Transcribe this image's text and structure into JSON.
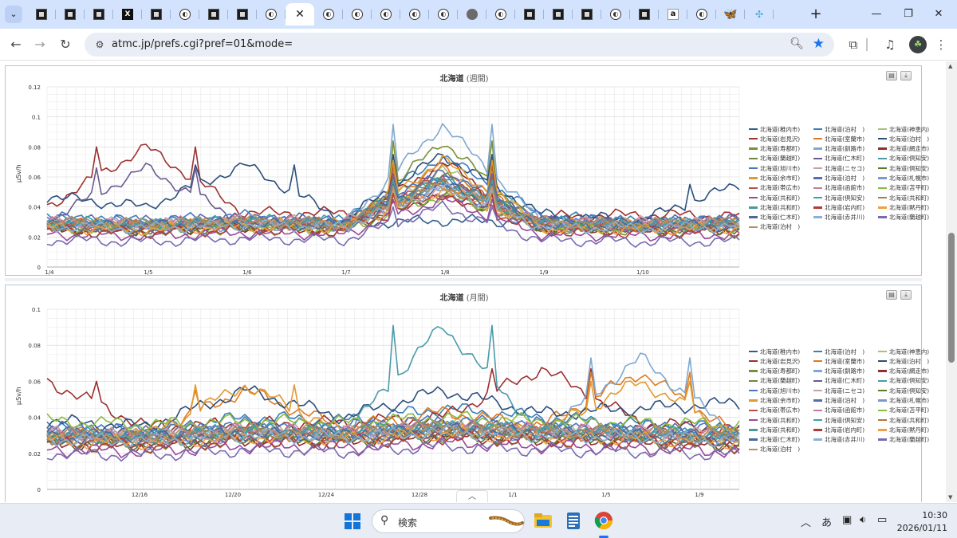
{
  "browser": {
    "tabs": [
      {
        "icon": "nerv-favicon"
      },
      {
        "icon": "nerv-favicon"
      },
      {
        "icon": "nerv-favicon"
      },
      {
        "icon": "x-favicon",
        "glyph": "X"
      },
      {
        "icon": "nerv-favicon"
      },
      {
        "icon": "circle-favicon",
        "glyph": "◐"
      },
      {
        "icon": "nerv-favicon"
      },
      {
        "icon": "nerv-favicon"
      },
      {
        "icon": "circle-favicon",
        "glyph": "◐"
      },
      {
        "icon": "close-icon",
        "glyph": "✕",
        "active": true
      },
      {
        "icon": "circle-favicon",
        "glyph": "◐"
      },
      {
        "icon": "circle-favicon",
        "glyph": "◐"
      },
      {
        "icon": "circle-favicon",
        "glyph": "◐"
      },
      {
        "icon": "circle-favicon",
        "glyph": "◐"
      },
      {
        "icon": "circle-favicon",
        "glyph": "◐"
      },
      {
        "icon": "globe-favicon"
      },
      {
        "icon": "circle-favicon",
        "glyph": "◐"
      },
      {
        "icon": "nerv-favicon"
      },
      {
        "icon": "nerv-favicon"
      },
      {
        "icon": "nerv-favicon"
      },
      {
        "icon": "circle-favicon",
        "glyph": "◐"
      },
      {
        "icon": "nerv-favicon"
      },
      {
        "icon": "amazon-favicon",
        "glyph": "a"
      },
      {
        "icon": "circle-favicon",
        "glyph": "◐"
      },
      {
        "icon": "bluesky-favicon",
        "glyph": "🦋"
      },
      {
        "icon": "dots-favicon",
        "glyph": "✣"
      }
    ],
    "new_tab_glyph": "+",
    "url": "atmc.jp/prefs.cgi?pref=01&mode="
  },
  "charts": {
    "week": {
      "pref_title": "北海道",
      "period": "(週間)",
      "ylabel": "μSv/h",
      "yticks": [
        "0",
        "0.02",
        "0.04",
        "0.06",
        "0.08",
        "0.1",
        "0.12"
      ],
      "xticks": [
        "1/4",
        "1/5",
        "1/6",
        "1/7",
        "1/8",
        "1/9",
        "1/10"
      ]
    },
    "month": {
      "pref_title": "北海道",
      "period": "(月間)",
      "ylabel": "μSv/h",
      "yticks": [
        "0",
        "0.02",
        "0.04",
        "0.06",
        "0.08",
        "0.1"
      ],
      "xticks": [
        "12/16",
        "12/20",
        "12/24",
        "12/28",
        "1/1",
        "1/5",
        "1/9"
      ]
    }
  },
  "chart_data": [
    {
      "type": "line",
      "title": "北海道 (週間)",
      "ylabel": "μSv/h",
      "ylim": [
        0,
        0.12
      ],
      "x": [
        "1/4",
        "1/5",
        "1/6",
        "1/7",
        "1/8",
        "1/9",
        "1/10"
      ],
      "legend_position": "right",
      "grid": true,
      "series": [
        {
          "name": "北海道(稚内市)",
          "color": "#2f5f8f",
          "values": [
            0.03,
            0.028,
            0.032,
            0.029,
            0.031,
            0.03,
            0.028,
            0.029
          ]
        },
        {
          "name": "北海道(泊村　)",
          "color": "#3a7fb8",
          "values": [
            0.032,
            0.03,
            0.029,
            0.031,
            0.074,
            0.034,
            0.03,
            0.031
          ]
        },
        {
          "name": "北海道(神恵内)",
          "color": "#a8c07a",
          "values": [
            0.029,
            0.027,
            0.03,
            0.028,
            0.065,
            0.03,
            0.029,
            0.028
          ]
        },
        {
          "name": "北海道(岩見沢)",
          "color": "#9c3030",
          "values": [
            0.04,
            0.08,
            0.036,
            0.036,
            0.046,
            0.033,
            0.035,
            0.034
          ]
        },
        {
          "name": "北海道(室蘭市)",
          "color": "#e07a20",
          "values": [
            0.029,
            0.028,
            0.03,
            0.029,
            0.066,
            0.028,
            0.029,
            0.03
          ]
        },
        {
          "name": "北海道(泊村　)",
          "color": "#2c4f7c",
          "values": [
            0.047,
            0.04,
            0.068,
            0.031,
            0.075,
            0.035,
            0.031,
            0.055
          ]
        },
        {
          "name": "北海道(寿都町)",
          "color": "#7a8f3a",
          "values": [
            0.024,
            0.023,
            0.025,
            0.024,
            0.084,
            0.026,
            0.025,
            0.023
          ]
        },
        {
          "name": "北海道(釧路市)",
          "color": "#7fa8d0",
          "values": [
            0.028,
            0.029,
            0.027,
            0.028,
            0.095,
            0.03,
            0.028,
            0.029
          ]
        },
        {
          "name": "北海道(網走市)",
          "color": "#8f2f2f",
          "values": [
            0.026,
            0.025,
            0.027,
            0.025,
            0.07,
            0.026,
            0.025,
            0.026
          ]
        },
        {
          "name": "北海道(蘭越町)",
          "color": "#6a8a3a",
          "values": [
            0.027,
            0.026,
            0.028,
            0.027,
            0.06,
            0.027,
            0.026,
            0.027
          ]
        },
        {
          "name": "北海道(仁木町)",
          "color": "#6a5a8f",
          "values": [
            0.031,
            0.066,
            0.029,
            0.03,
            0.055,
            0.03,
            0.029,
            0.031
          ]
        },
        {
          "name": "北海道(倶知安)",
          "color": "#4a9aaa",
          "values": [
            0.028,
            0.027,
            0.029,
            0.028,
            0.058,
            0.028,
            0.027,
            0.028
          ]
        },
        {
          "name": "北海道(旭川市)",
          "color": "#4a76c0",
          "values": [
            0.033,
            0.031,
            0.034,
            0.03,
            0.062,
            0.032,
            0.03,
            0.031
          ]
        },
        {
          "name": "北海道(ニセコ)",
          "color": "#c8a0a0",
          "values": [
            0.03,
            0.029,
            0.031,
            0.03,
            0.055,
            0.029,
            0.03,
            0.029
          ]
        },
        {
          "name": "北海道(倶知安)",
          "color": "#5a7a2a",
          "values": [
            0.025,
            0.024,
            0.026,
            0.025,
            0.05,
            0.025,
            0.024,
            0.025
          ]
        },
        {
          "name": "北海道(余市町)",
          "color": "#e09a30",
          "values": [
            0.029,
            0.028,
            0.03,
            0.028,
            0.071,
            0.029,
            0.028,
            0.029
          ]
        },
        {
          "name": "北海道(泊村　)",
          "color": "#5a6ab0",
          "values": [
            0.031,
            0.03,
            0.032,
            0.03,
            0.062,
            0.031,
            0.03,
            0.031
          ]
        },
        {
          "name": "北海道(札幌市)",
          "color": "#7a9ac8",
          "values": [
            0.027,
            0.026,
            0.028,
            0.026,
            0.052,
            0.026,
            0.027,
            0.026
          ]
        },
        {
          "name": "北海道(帯広市)",
          "color": "#b8504a",
          "values": [
            0.028,
            0.027,
            0.029,
            0.027,
            0.06,
            0.028,
            0.027,
            0.028
          ]
        },
        {
          "name": "北海道(函館市)",
          "color": "#c87a9a",
          "values": [
            0.03,
            0.029,
            0.031,
            0.029,
            0.05,
            0.03,
            0.029,
            0.03
          ]
        },
        {
          "name": "北海道(苫平町)",
          "color": "#8aba40",
          "values": [
            0.026,
            0.025,
            0.027,
            0.025,
            0.048,
            0.026,
            0.025,
            0.026
          ]
        },
        {
          "name": "北海道(共和町)",
          "color": "#9a4a9a",
          "values": [
            0.022,
            0.021,
            0.023,
            0.022,
            0.045,
            0.022,
            0.021,
            0.022
          ]
        },
        {
          "name": "北海道(倶知安)",
          "color": "#3aa0b0",
          "values": [
            0.03,
            0.029,
            0.031,
            0.03,
            0.058,
            0.03,
            0.029,
            0.03
          ]
        },
        {
          "name": "北海道(共和町)",
          "color": "#b07a40",
          "values": [
            0.028,
            0.027,
            0.029,
            0.028,
            0.056,
            0.028,
            0.027,
            0.028
          ]
        },
        {
          "name": "北海道(共和町)",
          "color": "#4a9a9a",
          "values": [
            0.029,
            0.028,
            0.03,
            0.029,
            0.057,
            0.029,
            0.028,
            0.029
          ]
        },
        {
          "name": "北海道(岩内町)",
          "color": "#b03a3a",
          "values": [
            0.024,
            0.023,
            0.025,
            0.024,
            0.049,
            0.024,
            0.023,
            0.024
          ]
        },
        {
          "name": "北海道(黙丹町)",
          "color": "#f0a040",
          "values": [
            0.026,
            0.025,
            0.027,
            0.026,
            0.052,
            0.026,
            0.025,
            0.026
          ]
        },
        {
          "name": "北海道(仁木町)",
          "color": "#4a6a9a",
          "values": [
            0.028,
            0.027,
            0.029,
            0.028,
            0.055,
            0.028,
            0.027,
            0.028
          ]
        },
        {
          "name": "北海道(赤井川)",
          "color": "#8ab0d8",
          "values": [
            0.027,
            0.026,
            0.028,
            0.027,
            0.053,
            0.027,
            0.026,
            0.027
          ]
        },
        {
          "name": "北海道(蘭越町)",
          "color": "#7a6ab0",
          "values": [
            0.018,
            0.017,
            0.019,
            0.018,
            0.04,
            0.018,
            0.017,
            0.017
          ]
        },
        {
          "name": "北海道(泊村　)",
          "color": "#b89060",
          "values": [
            0.03,
            0.029,
            0.031,
            0.029,
            0.054,
            0.03,
            0.029,
            0.03
          ]
        }
      ]
    },
    {
      "type": "line",
      "title": "北海道 (月間)",
      "ylabel": "μSv/h",
      "ylim": [
        0,
        0.1
      ],
      "x": [
        "12/16",
        "12/20",
        "12/24",
        "12/28",
        "1/1",
        "1/5",
        "1/9"
      ],
      "legend_position": "right",
      "grid": true,
      "series": [
        {
          "name": "北海道(稚内市)",
          "color": "#2f5f8f",
          "values": [
            0.032,
            0.03,
            0.033,
            0.031,
            0.034,
            0.032,
            0.033,
            0.031
          ]
        },
        {
          "name": "北海道(泊村　)",
          "color": "#3a7fb8",
          "values": [
            0.034,
            0.032,
            0.04,
            0.038,
            0.045,
            0.04,
            0.036,
            0.034
          ]
        },
        {
          "name": "北海道(神恵内)",
          "color": "#a8c07a",
          "values": [
            0.03,
            0.029,
            0.033,
            0.031,
            0.036,
            0.033,
            0.031,
            0.03
          ]
        },
        {
          "name": "北海道(岩見沢)",
          "color": "#9c3030",
          "values": [
            0.06,
            0.035,
            0.036,
            0.037,
            0.04,
            0.067,
            0.037,
            0.033
          ]
        },
        {
          "name": "北海道(室蘭市)",
          "color": "#e07a20",
          "values": [
            0.031,
            0.03,
            0.055,
            0.034,
            0.043,
            0.035,
            0.065,
            0.03
          ]
        },
        {
          "name": "北海道(泊村　)",
          "color": "#2c4f7c",
          "values": [
            0.038,
            0.035,
            0.055,
            0.04,
            0.055,
            0.042,
            0.045,
            0.048
          ]
        },
        {
          "name": "北海道(寿都町)",
          "color": "#7a8f3a",
          "values": [
            0.025,
            0.024,
            0.027,
            0.026,
            0.03,
            0.027,
            0.026,
            0.024
          ]
        },
        {
          "name": "北海道(釧路市)",
          "color": "#7fa8d0",
          "values": [
            0.029,
            0.028,
            0.03,
            0.029,
            0.033,
            0.03,
            0.073,
            0.029
          ]
        },
        {
          "name": "北海道(網走市)",
          "color": "#8f2f2f",
          "values": [
            0.026,
            0.025,
            0.028,
            0.027,
            0.03,
            0.028,
            0.027,
            0.025
          ]
        },
        {
          "name": "北海道(蘭越町)",
          "color": "#6a8a3a",
          "values": [
            0.028,
            0.027,
            0.03,
            0.029,
            0.032,
            0.03,
            0.029,
            0.027
          ]
        },
        {
          "name": "北海道(仁木町)",
          "color": "#6a5a8f",
          "values": [
            0.031,
            0.03,
            0.033,
            0.032,
            0.035,
            0.033,
            0.032,
            0.03
          ]
        },
        {
          "name": "北海道(倶知安)",
          "color": "#4a9aaa",
          "values": [
            0.029,
            0.028,
            0.031,
            0.03,
            0.091,
            0.031,
            0.03,
            0.028
          ]
        },
        {
          "name": "北海道(旭川市)",
          "color": "#4a76c0",
          "values": [
            0.034,
            0.033,
            0.036,
            0.035,
            0.038,
            0.036,
            0.035,
            0.033
          ]
        },
        {
          "name": "北海道(ニセコ)",
          "color": "#c8a0a0",
          "values": [
            0.031,
            0.03,
            0.033,
            0.032,
            0.035,
            0.033,
            0.032,
            0.03
          ]
        },
        {
          "name": "北海道(倶知安)",
          "color": "#5a7a2a",
          "values": [
            0.026,
            0.025,
            0.028,
            0.027,
            0.03,
            0.028,
            0.027,
            0.025
          ]
        },
        {
          "name": "北海道(余市町)",
          "color": "#e09a30",
          "values": [
            0.03,
            0.029,
            0.058,
            0.031,
            0.034,
            0.032,
            0.06,
            0.029
          ]
        },
        {
          "name": "北海道(泊村　)",
          "color": "#5a6ab0",
          "values": [
            0.032,
            0.031,
            0.034,
            0.033,
            0.036,
            0.034,
            0.033,
            0.031
          ]
        },
        {
          "name": "北海道(札幌市)",
          "color": "#7a9ac8",
          "values": [
            0.028,
            0.027,
            0.03,
            0.029,
            0.032,
            0.03,
            0.029,
            0.027
          ]
        },
        {
          "name": "北海道(帯広市)",
          "color": "#b8504a",
          "values": [
            0.029,
            0.028,
            0.031,
            0.03,
            0.033,
            0.031,
            0.03,
            0.028
          ]
        },
        {
          "name": "北海道(函館市)",
          "color": "#c87a9a",
          "values": [
            0.031,
            0.03,
            0.033,
            0.032,
            0.035,
            0.033,
            0.032,
            0.03
          ]
        },
        {
          "name": "北海道(苫平町)",
          "color": "#8aba40",
          "values": [
            0.038,
            0.036,
            0.038,
            0.037,
            0.04,
            0.038,
            0.037,
            0.036
          ]
        },
        {
          "name": "北海道(共和町)",
          "color": "#9a4a9a",
          "values": [
            0.022,
            0.021,
            0.024,
            0.023,
            0.026,
            0.024,
            0.023,
            0.021
          ]
        },
        {
          "name": "北海道(倶知安)",
          "color": "#3aa0b0",
          "values": [
            0.031,
            0.03,
            0.033,
            0.032,
            0.035,
            0.033,
            0.032,
            0.03
          ]
        },
        {
          "name": "北海道(共和町)",
          "color": "#b07a40",
          "values": [
            0.029,
            0.028,
            0.031,
            0.03,
            0.033,
            0.031,
            0.03,
            0.028
          ]
        },
        {
          "name": "北海道(共和町)",
          "color": "#4a9a9a",
          "values": [
            0.03,
            0.029,
            0.032,
            0.031,
            0.034,
            0.032,
            0.031,
            0.029
          ]
        },
        {
          "name": "北海道(岩内町)",
          "color": "#b03a3a",
          "values": [
            0.025,
            0.024,
            0.027,
            0.026,
            0.029,
            0.027,
            0.026,
            0.024
          ]
        },
        {
          "name": "北海道(黙丹町)",
          "color": "#f0a040",
          "values": [
            0.027,
            0.026,
            0.029,
            0.028,
            0.031,
            0.029,
            0.028,
            0.026
          ]
        },
        {
          "name": "北海道(仁木町)",
          "color": "#4a6a9a",
          "values": [
            0.029,
            0.028,
            0.031,
            0.03,
            0.033,
            0.031,
            0.03,
            0.028
          ]
        },
        {
          "name": "北海道(赤井川)",
          "color": "#8ab0d8",
          "values": [
            0.028,
            0.027,
            0.03,
            0.029,
            0.032,
            0.03,
            0.029,
            0.027
          ]
        },
        {
          "name": "北海道(蘭越町)",
          "color": "#7a6ab0",
          "values": [
            0.02,
            0.019,
            0.022,
            0.021,
            0.024,
            0.022,
            0.021,
            0.019
          ]
        },
        {
          "name": "北海道(泊村　)",
          "color": "#b89060",
          "values": [
            0.031,
            0.03,
            0.033,
            0.032,
            0.035,
            0.033,
            0.032,
            0.03
          ]
        }
      ]
    }
  ],
  "taskbar": {
    "search_label": "検索",
    "ime_label": "あ",
    "clock_time": "10:30",
    "clock_date": "2026/01/11"
  }
}
